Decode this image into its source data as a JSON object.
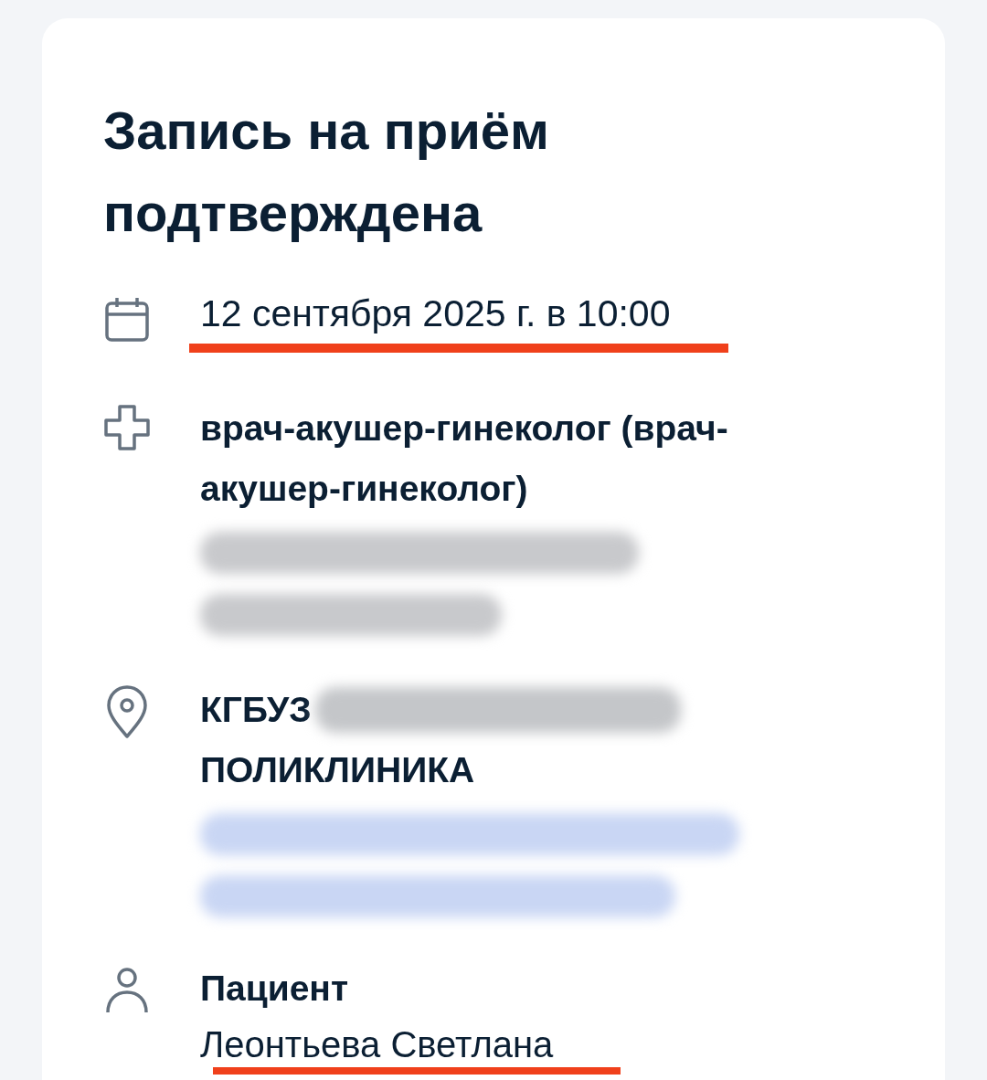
{
  "card": {
    "title": "Запись на приём подтверждена",
    "details": [
      {
        "kind": "date",
        "redacted": false,
        "lines": [
          {
            "text": "12 сентября 2025 г. в 10:00",
            "underlined": true,
            "redacted_after": false
          }
        ]
      },
      {
        "kind": "specialty",
        "redacted": true,
        "lines": [
          {
            "text": "врач-акушер-гинеколог (врач-акушер-гинеколог)",
            "underlined": false,
            "redacted_after": false
          }
        ]
      },
      {
        "kind": "location",
        "redacted": true,
        "lines": [
          {
            "text": "КГБУЗ",
            "underlined": false,
            "redacted_after": true
          },
          {
            "text": "ПОЛИКЛИНИКА",
            "underlined": false,
            "redacted_after": false
          }
        ]
      },
      {
        "kind": "patient",
        "redacted": false,
        "label": "Пациент",
        "lines": [
          {
            "text": "Леонтьева Светлана",
            "underlined": true,
            "redacted_after": false
          }
        ]
      }
    ]
  }
}
